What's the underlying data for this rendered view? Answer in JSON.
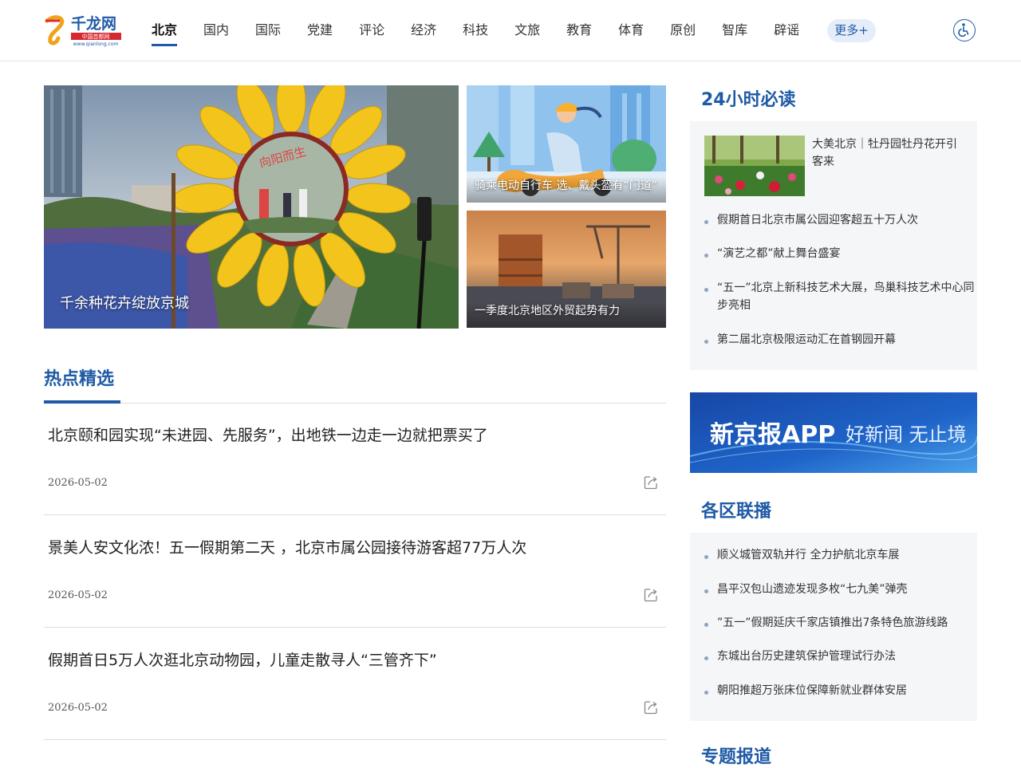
{
  "header": {
    "logo_text": "千龙网",
    "logo_subtitle": "中国首都网",
    "logo_url": "www.qianlong.com",
    "nav": [
      "北京",
      "国内",
      "国际",
      "党建",
      "评论",
      "经济",
      "科技",
      "文旅",
      "教育",
      "体育",
      "原创",
      "智库",
      "辟谣"
    ],
    "more_label": "更多+"
  },
  "hero": {
    "main_caption": "千余种花卉绽放京城",
    "mirror_text": "向阳而生",
    "side1_caption": "骑乘电动自行车 选、戴头盔有“门道”",
    "side2_caption": "一季度北京地区外贸起势有力"
  },
  "hot": {
    "title": "热点精选",
    "articles": [
      {
        "title": "北京颐和园实现“未进园、先服务”，出地铁一边走一边就把票买了",
        "date": "2026-05-02"
      },
      {
        "title": "景美人安文化浓！五一假期第二天 ，北京市属公园接待游客超77万人次",
        "date": "2026-05-02"
      },
      {
        "title": "假期首日5万人次逛北京动物园，儿童走散寻人“三管齐下”",
        "date": "2026-05-02"
      }
    ]
  },
  "must_read": {
    "title": "24小时必读",
    "top_item": "大美北京｜牡丹园牡丹花开引客来",
    "items": [
      "假期首日北京市属公园迎客超五十万人次",
      "“演艺之都”献上舞台盛宴",
      "“五一”北京上新科技艺术大展，鸟巢科技艺术中心同步亮相",
      "第二届北京极限运动汇在首钢园开幕"
    ]
  },
  "banner": {
    "text1": "新京报APP",
    "text2": "好新闻 无止境"
  },
  "districts": {
    "title": "各区联播",
    "items": [
      "顺义城管双轨并行 全力护航北京车展",
      "昌平汉包山遗迹发现多枚“七九美”弹壳",
      "”五一”假期延庆千家店镇推出7条特色旅游线路",
      "东城出台历史建筑保护管理试行办法",
      "朝阳推超万张床位保障新就业群体安居"
    ]
  },
  "topics": {
    "title": "专题报道"
  }
}
